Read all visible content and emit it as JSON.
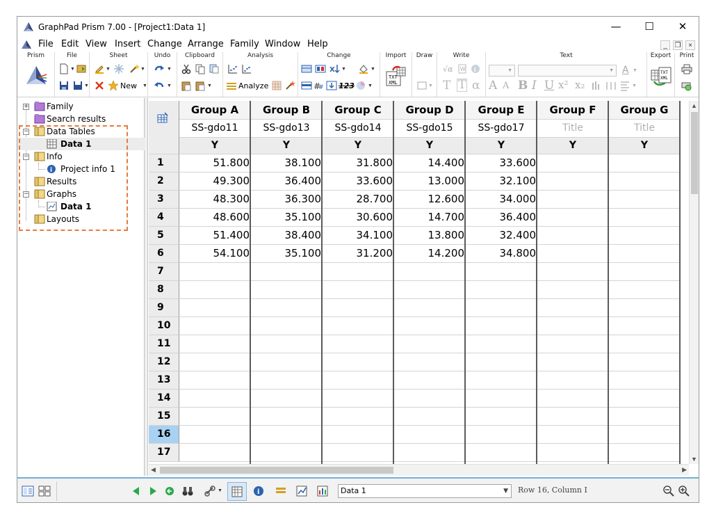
{
  "window": {
    "title": "GraphPad Prism 7.00 - [Project1:Data 1]",
    "minimize": "—",
    "maximize": "☐",
    "close": "✕",
    "mdi_min": "_",
    "mdi_restore": "❐",
    "mdi_close": "×"
  },
  "menu": [
    "File",
    "Edit",
    "View",
    "Insert",
    "Change",
    "Arrange",
    "Family",
    "Window",
    "Help"
  ],
  "toolbar": {
    "groups": [
      "Prism",
      "File",
      "Sheet",
      "Undo",
      "Clipboard",
      "Analysis",
      "Change",
      "Import",
      "Draw",
      "Write",
      "Text",
      "Export",
      "Print"
    ],
    "new_label": "New",
    "analyze_label": "Analyze",
    "change_123": "123",
    "text_tools": [
      "A",
      "A",
      "B",
      "I",
      "U",
      "x²",
      "x₂"
    ],
    "write_tools": [
      "T",
      "T",
      "α"
    ]
  },
  "navigator": {
    "items": [
      {
        "label": "Family",
        "level": 0
      },
      {
        "label": "Search results",
        "level": 0
      },
      {
        "label": "Data Tables",
        "level": 0
      },
      {
        "label": "Data 1",
        "level": 1
      },
      {
        "label": "Info",
        "level": 0
      },
      {
        "label": "Project info 1",
        "level": 1
      },
      {
        "label": "Results",
        "level": 0
      },
      {
        "label": "Graphs",
        "level": 0
      },
      {
        "label": "Data 1",
        "level": 1
      },
      {
        "label": "Layouts",
        "level": 0
      }
    ]
  },
  "sheet": {
    "columns": [
      {
        "group": "Group A",
        "title": "SS-gdo11",
        "sub": "Y"
      },
      {
        "group": "Group B",
        "title": "SS-gdo13",
        "sub": "Y"
      },
      {
        "group": "Group C",
        "title": "SS-gdo14",
        "sub": "Y"
      },
      {
        "group": "Group D",
        "title": "SS-gdo15",
        "sub": "Y"
      },
      {
        "group": "Group E",
        "title": "SS-gdo17",
        "sub": "Y"
      },
      {
        "group": "Group F",
        "title": "Title",
        "sub": "Y",
        "placeholder": true
      },
      {
        "group": "Group G",
        "title": "Title",
        "sub": "Y",
        "placeholder": true
      }
    ],
    "rows": [
      [
        "51.800",
        "38.100",
        "31.800",
        "14.400",
        "33.600"
      ],
      [
        "49.300",
        "36.400",
        "33.600",
        "13.000",
        "32.100"
      ],
      [
        "48.300",
        "36.300",
        "28.700",
        "12.600",
        "34.000"
      ],
      [
        "48.600",
        "35.100",
        "30.600",
        "14.700",
        "36.400"
      ],
      [
        "51.400",
        "38.400",
        "34.100",
        "13.800",
        "32.400"
      ],
      [
        "54.100",
        "35.100",
        "31.200",
        "14.200",
        "34.800"
      ]
    ],
    "row_numbers": [
      "1",
      "2",
      "3",
      "4",
      "5",
      "6",
      "7",
      "8",
      "9",
      "10",
      "11",
      "12",
      "13",
      "14",
      "15",
      "16",
      "17"
    ],
    "active_row": "16"
  },
  "status": {
    "sheet_select": "Data 1",
    "position": "Row 16, Column I"
  },
  "colors": {
    "accent": "#6fb1d4",
    "highlight": "#e87a3b",
    "active_row": "#a9d1f2"
  }
}
